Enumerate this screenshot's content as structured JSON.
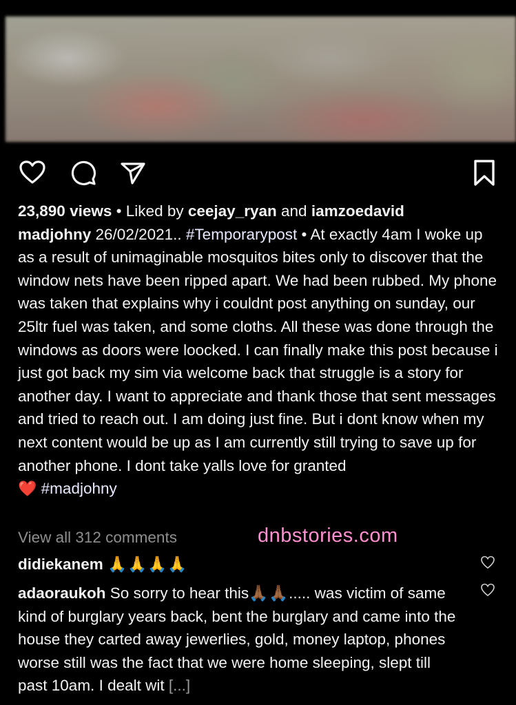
{
  "post": {
    "views": "23,890 views",
    "liked_by_prefix": "Liked by",
    "liked_user1": "ceejay_ryan",
    "liked_and": "and",
    "liked_user2": "iamzoedavid",
    "separator": "•",
    "username": "madjohny",
    "caption_date": "26/02/2021..",
    "caption_tag": "#Temporarypost",
    "caption_text": "At exactly 4am I woke up as a result of unimaginable mosquitos bites only to discover that the window nets have been ripped apart. We had been rubbed. My phone was taken that explains why i couldnt post anything on sunday, our 25ltr fuel was taken, and some cloths. All these was done through the windows as doors were loocked. I can finally make this post because i just got back my sim via welcome back that struggle is a story for another day. I want to appreciate and thank those that sent messages and tried to reach out. I am doing just fine. But i dont know when my next content would be up as I am currently still trying to save up for another phone. I dont take yalls love for granted",
    "caption_emoji": "❤️",
    "caption_end_tag": "#madjohny",
    "view_all_comments": "View all 312 comments"
  },
  "watermark": "dnbstories.com",
  "comments": [
    {
      "username": "didiekanem",
      "emoji": "🙏🙏🙏🙏",
      "text": ""
    },
    {
      "username": "adaoraukoh",
      "text_before": "So sorry to hear this",
      "emoji": "🙏🏾🙏🏾",
      "text_after": "..... was victim of same kind of burglary years back, bent the burglary and came into the house they carted away jewerlies, gold, money laptop, phones worse still was the fact that we were home sleeping, slept till past 10am. I dealt wit",
      "more": "[...]"
    }
  ],
  "icons": {
    "like": "heart-icon",
    "comment": "comment-icon",
    "share": "send-icon",
    "save": "bookmark-icon",
    "comment_like": "heart-outline-icon"
  },
  "colors": {
    "background": "#000000",
    "text": "#f2f2f2",
    "muted": "#8e8e8e",
    "watermark": "#ff8fd0",
    "heart_red": "#e0242b"
  }
}
